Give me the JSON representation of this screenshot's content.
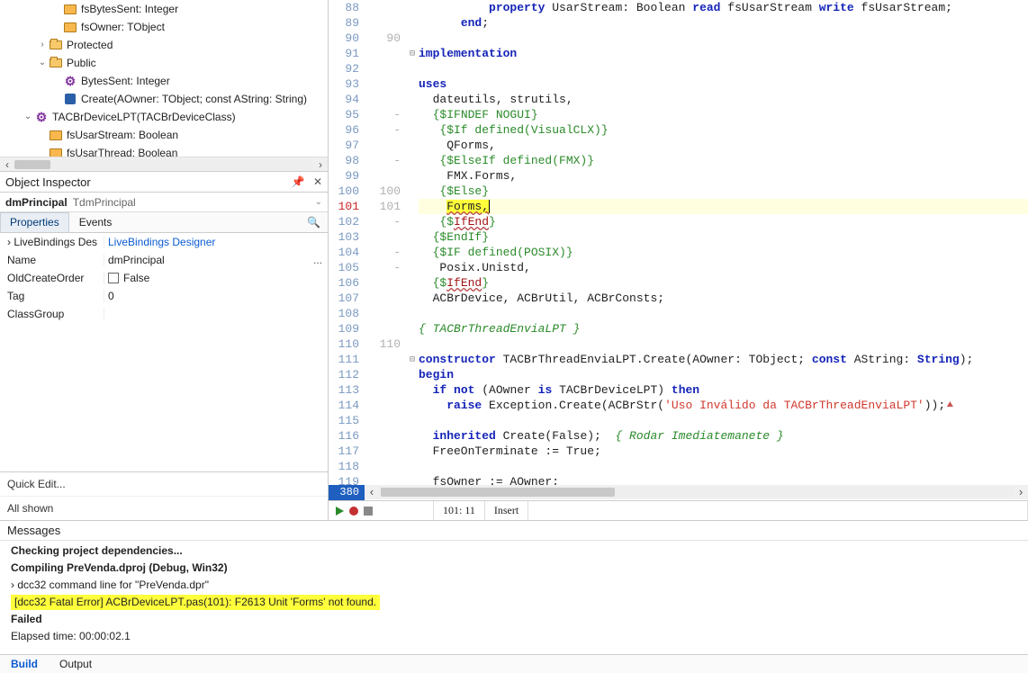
{
  "tree": {
    "items": [
      {
        "indent": 3,
        "twisty": "",
        "iconClass": "ico-field",
        "label": "fsBytesSent: Integer"
      },
      {
        "indent": 3,
        "twisty": "",
        "iconClass": "ico-field",
        "label": "fsOwner: TObject"
      },
      {
        "indent": 2,
        "twisty": "›",
        "iconClass": "ico-folder-open",
        "label": "Protected"
      },
      {
        "indent": 2,
        "twisty": "⌄",
        "iconClass": "ico-folder-open",
        "label": "Public"
      },
      {
        "indent": 3,
        "twisty": "",
        "iconClass": "ico-method",
        "iconText": "⚙",
        "label": "BytesSent: Integer"
      },
      {
        "indent": 3,
        "twisty": "",
        "iconClass": "ico-ctor",
        "label": "Create(AOwner: TObject; const AString: String)"
      },
      {
        "indent": 1,
        "twisty": "⌄",
        "iconClass": "ico-method",
        "iconText": "⚙",
        "label": "TACBrDeviceLPT(TACBrDeviceClass)"
      },
      {
        "indent": 2,
        "twisty": "",
        "iconClass": "ico-field",
        "label": "fsUsarStream: Boolean"
      },
      {
        "indent": 2,
        "twisty": "",
        "iconClass": "ico-field",
        "label": "fsUsarThread: Boolean"
      }
    ]
  },
  "object_inspector": {
    "title": "Object Inspector",
    "pin_icon": "📌",
    "close_icon": "✕",
    "combo_name": "dmPrincipal",
    "combo_type": "TdmPrincipal",
    "tabs": {
      "properties": "Properties",
      "events": "Events"
    },
    "search_icon": "🔍",
    "rows": [
      {
        "name": "LiveBindings Des",
        "value": "LiveBindings Designer",
        "link": true,
        "twisty": "›"
      },
      {
        "name": "Name",
        "value": "dmPrincipal",
        "selected": true,
        "ellipsis": "..."
      },
      {
        "name": "OldCreateOrder",
        "value": "False",
        "checkbox": true
      },
      {
        "name": "Tag",
        "value": "0"
      },
      {
        "name": "ClassGroup",
        "value": ""
      }
    ],
    "quick_edit": "Quick Edit...",
    "all_shown": "All shown"
  },
  "editor": {
    "lines": [
      {
        "n": 88,
        "fold": "",
        "html": "          <span class='kw'>property</span> UsarStream: Boolean <span class='kw'>read</span> fsUsarStream <span class='kw'>write</span> fsUsarStream;"
      },
      {
        "n": 89,
        "fold": "",
        "html": "      <span class='kw'>end</span>;"
      },
      {
        "n": 90,
        "sync": "90",
        "fold": "",
        "html": ""
      },
      {
        "n": 91,
        "fold": "⊟",
        "html": "<span class='kw'>implementation</span>"
      },
      {
        "n": 92,
        "fold": "",
        "html": ""
      },
      {
        "n": 93,
        "fold": "",
        "html": "<span class='kw'>uses</span>"
      },
      {
        "n": 94,
        "fold": "",
        "html": "  dateutils, strutils,"
      },
      {
        "n": 95,
        "sync": "-",
        "fold": "",
        "html": "  <span class='dir'>{$IFNDEF NOGUI}</span>"
      },
      {
        "n": 96,
        "sync": "-",
        "fold": "",
        "html": "   <span class='dir'>{$If defined(VisualCLX)}</span>"
      },
      {
        "n": 97,
        "fold": "",
        "html": "    QForms,"
      },
      {
        "n": 98,
        "sync": "-",
        "fold": "",
        "html": "   <span class='dir'>{$ElseIf defined(FMX)}</span>"
      },
      {
        "n": 99,
        "fold": "",
        "html": "    FMX.Forms,"
      },
      {
        "n": 100,
        "sync": "100",
        "fold": "",
        "html": "   <span class='dir'>{$Else}</span>"
      },
      {
        "n": 101,
        "sync": "101",
        "red": true,
        "hl": true,
        "fold": "",
        "html": "    <span class='err-word'>Forms</span><span class='err-word'>,</span><span class='caret'></span>"
      },
      {
        "n": 102,
        "sync": "-",
        "fold": "",
        "html": "   <span class='dir'>{$<span class='id-u'>IfEnd</span>}</span>"
      },
      {
        "n": 103,
        "fold": "",
        "html": "  <span class='dir'>{$EndIf}</span>"
      },
      {
        "n": 104,
        "sync": "-",
        "fold": "",
        "html": "  <span class='dir'>{$IF defined(POSIX)}</span>"
      },
      {
        "n": 105,
        "sync": "-",
        "fold": "",
        "html": "   Posix.Unistd,"
      },
      {
        "n": 106,
        "fold": "",
        "html": "  <span class='dir'>{$<span class='id-u'>IfEnd</span>}</span>"
      },
      {
        "n": 107,
        "fold": "",
        "html": "  ACBrDevice, ACBrUtil, ACBrConsts;"
      },
      {
        "n": 108,
        "fold": "",
        "html": ""
      },
      {
        "n": 109,
        "fold": "",
        "html": "<span class='cmt'>{ TACBrThreadEnviaLPT }</span>"
      },
      {
        "n": 110,
        "sync": "110",
        "fold": "",
        "html": ""
      },
      {
        "n": 111,
        "fold": "⊟",
        "html": "<span class='kw'>constructor</span> TACBrThreadEnviaLPT.Create(AOwner: TObject; <span class='kw'>const</span> AString: <span class='kw'>String</span>);"
      },
      {
        "n": 112,
        "fold": "",
        "html": "<span class='kw'>begin</span>"
      },
      {
        "n": 113,
        "fold": "",
        "html": "  <span class='kw'>if</span> <span class='kw'>not</span> (AOwner <span class='kw'>is</span> TACBrDeviceLPT) <span class='kw'>then</span>"
      },
      {
        "n": 114,
        "fold": "",
        "html": "    <span class='kw'>raise</span> Exception.Create(ACBrStr(<span class='str'>'Uso Inválido da TACBrThreadEnviaLPT'</span>));<span style='color:#c55'>⯅</span>"
      },
      {
        "n": 115,
        "fold": "",
        "html": ""
      },
      {
        "n": 116,
        "fold": "",
        "html": "  <span class='kw'>inherited</span> Create(False);  <span class='cmt'>{ Rodar Imediatemanete }</span>"
      },
      {
        "n": 117,
        "fold": "",
        "html": "  FreeOnTerminate := True;"
      },
      {
        "n": 118,
        "fold": "",
        "html": ""
      },
      {
        "n": 119,
        "fold": "",
        "html": "  fsOwner := AOwner;"
      }
    ],
    "total_lines": "380",
    "status_pos": "101: 11",
    "status_mode": "Insert"
  },
  "messages": {
    "title": "Messages",
    "rows": [
      {
        "text": "Checking project dependencies...",
        "bold": true
      },
      {
        "text": "Compiling PreVenda.dproj (Debug, Win32)",
        "bold": true
      },
      {
        "text": "dcc32 command line for \"PreVenda.dpr\"",
        "twisty": "›"
      },
      {
        "text": "[dcc32 Fatal Error] ACBrDeviceLPT.pas(101): F2613 Unit 'Forms' not found.",
        "hl": true
      },
      {
        "text": "Failed",
        "bold": true
      },
      {
        "text": "Elapsed time: 00:00:02.1"
      }
    ],
    "tabs": {
      "build": "Build",
      "output": "Output"
    }
  }
}
